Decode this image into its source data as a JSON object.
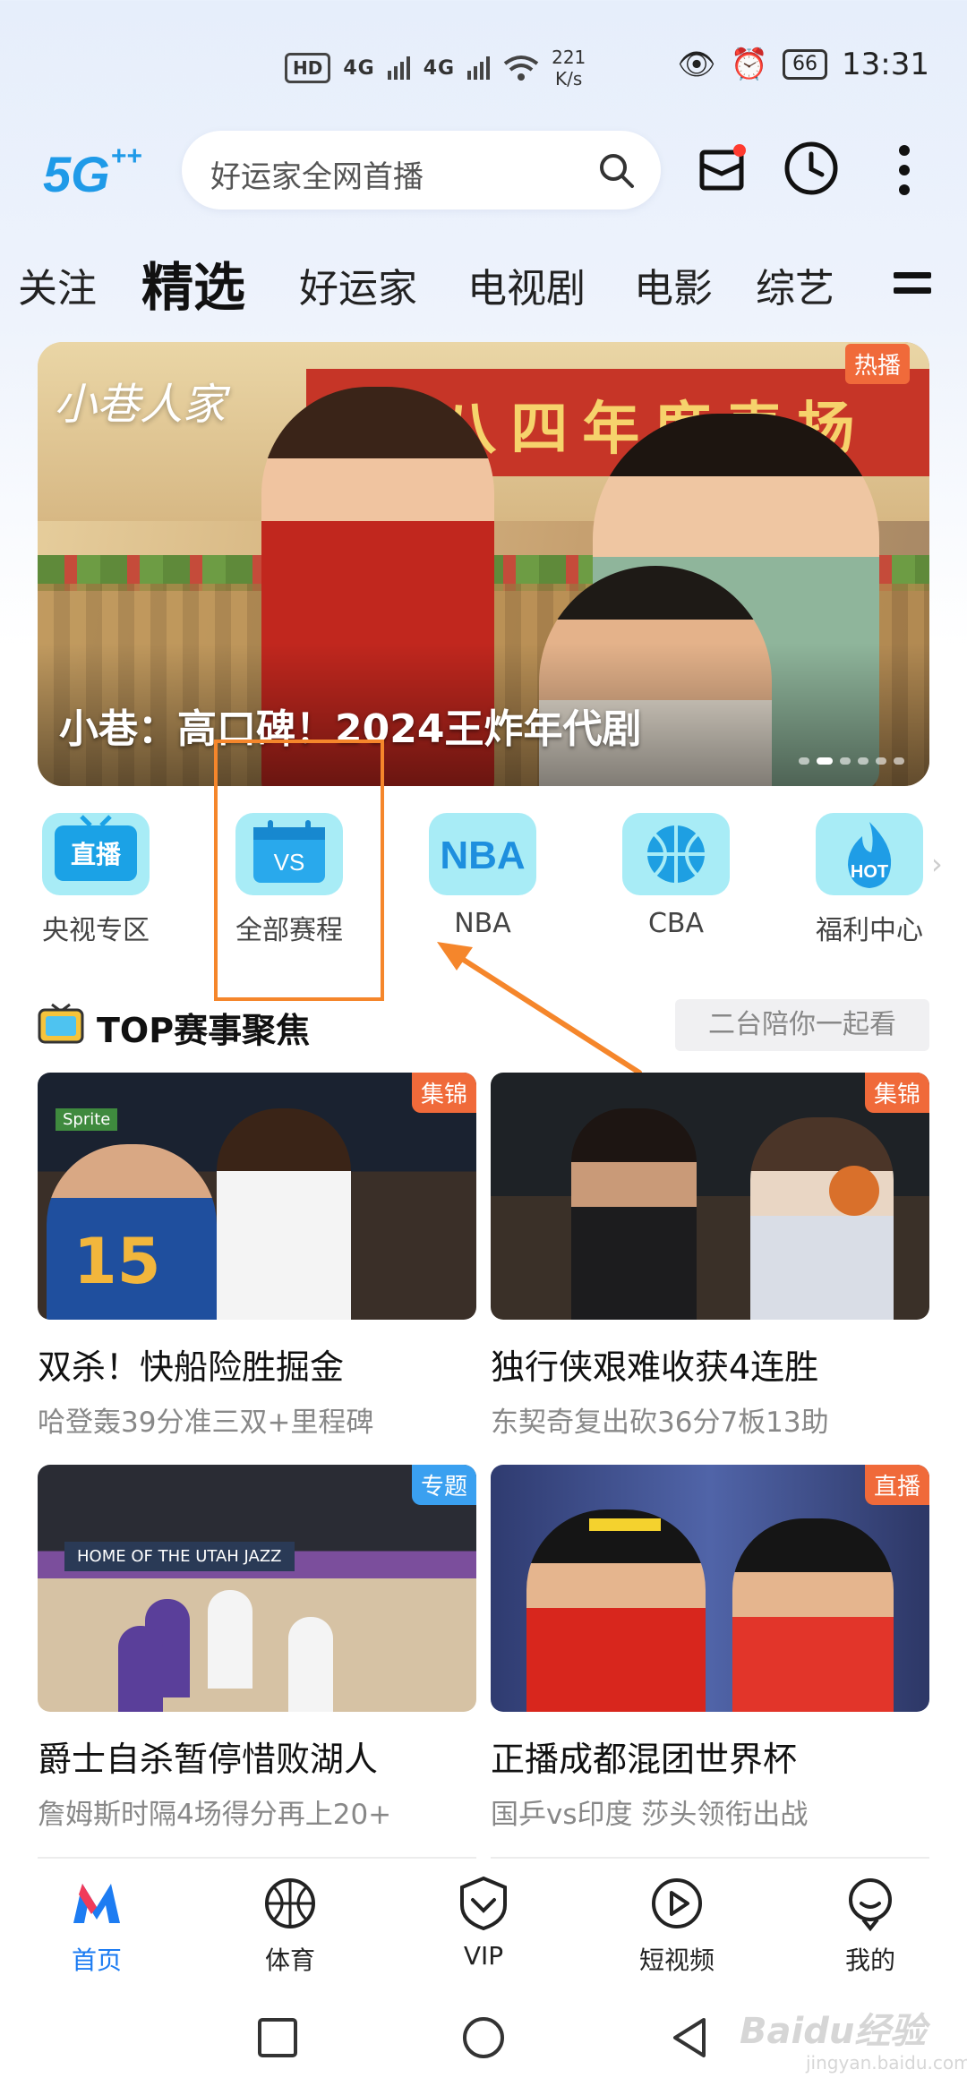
{
  "status_bar": {
    "hd": "HD",
    "signal1": "4G",
    "signal2": "4G",
    "speed_value": "221",
    "speed_unit": "K/s",
    "battery": "66",
    "time": "13:31"
  },
  "header": {
    "logo": "5G",
    "search_placeholder": "好运家全网首播"
  },
  "tabs": [
    "关注",
    "精选",
    "好运家",
    "电视剧",
    "电影",
    "综艺"
  ],
  "active_tab": "精选",
  "banner": {
    "logo_text": "小巷人家",
    "sign_text": "厂 八四年度表扬",
    "title": "小巷：高口碑！2024王炸年代剧",
    "badge": "热播",
    "dot_count": 6,
    "active_dot": 2
  },
  "quick_entries": [
    {
      "label": "央视专区",
      "icon": "live-tv-icon",
      "icon_text": "直播"
    },
    {
      "label": "全部赛程",
      "icon": "calendar-vs-icon",
      "icon_text": "VS"
    },
    {
      "label": "NBA",
      "icon": "nba-icon",
      "icon_text": "NBA"
    },
    {
      "label": "CBA",
      "icon": "basketball-icon",
      "icon_text": ""
    },
    {
      "label": "福利中心",
      "icon": "hot-flame-icon",
      "icon_text": "HOT"
    }
  ],
  "section": {
    "title": "TOP赛事聚焦",
    "more": "二台陪你一起看"
  },
  "cards": [
    {
      "title": "双杀！快船险胜掘金",
      "subtitle": "哈登轰39分准三双+里程碑",
      "badge": "集锦",
      "jersey": "15",
      "sign": "Sprite"
    },
    {
      "title": "独行侠艰难收获4连胜",
      "subtitle": "东契奇复出砍36分7板13助",
      "badge": "集锦"
    },
    {
      "title": "爵士自杀暂停惜败湖人",
      "subtitle": "詹姆斯时隔4场得分再上20+",
      "badge": "专题",
      "court_sign": "HOME OF THE UTAH JAZZ"
    },
    {
      "title": "正播成都混团世界杯",
      "subtitle": "国乒vs印度 莎头领衔出战",
      "badge": "直播"
    }
  ],
  "bottom_nav": [
    {
      "label": "首页",
      "icon": "home-m-icon",
      "active": true
    },
    {
      "label": "体育",
      "icon": "basketball-nav-icon",
      "active": false
    },
    {
      "label": "VIP",
      "icon": "vip-shield-icon",
      "active": false
    },
    {
      "label": "短视频",
      "icon": "play-circle-icon",
      "active": false
    },
    {
      "label": "我的",
      "icon": "profile-icon",
      "active": false
    }
  ],
  "watermark": {
    "text": "Baidu经验",
    "sub": "jingyan.baidu.com"
  },
  "colors": {
    "accent": "#1d7cf2",
    "highlight": "#f5862b",
    "badge": "#f06a3a",
    "badge_blue": "#3aa0f0",
    "quick_icon_bg": "#a8ecf6"
  }
}
